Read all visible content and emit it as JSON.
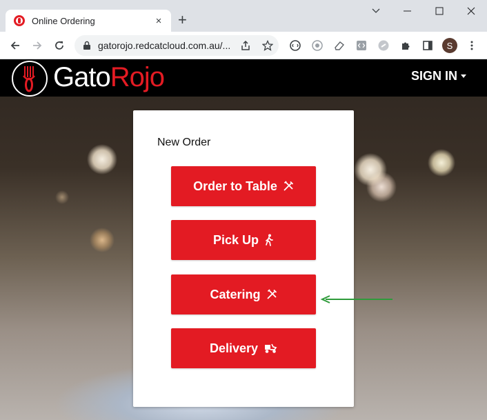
{
  "browser": {
    "tab_title": "Online Ordering",
    "tab_close": "×",
    "new_tab": "+",
    "url": "gatorojo.redcatcloud.com.au/...",
    "profile_initial": "S"
  },
  "site": {
    "logo_part1": "Gato",
    "logo_part2": "Rojo",
    "signin_label": "SIGN IN",
    "brand_color": "#e31b23"
  },
  "order_card": {
    "title": "New Order",
    "buttons": [
      {
        "label": "Order to Table",
        "icon": "cutlery-icon"
      },
      {
        "label": "Pick Up",
        "icon": "walking-person-icon"
      },
      {
        "label": "Catering",
        "icon": "cutlery-icon"
      },
      {
        "label": "Delivery",
        "icon": "delivery-scooter-icon"
      }
    ]
  },
  "annotation": {
    "arrow_color": "#2e9b3a",
    "points_to": "Catering"
  }
}
